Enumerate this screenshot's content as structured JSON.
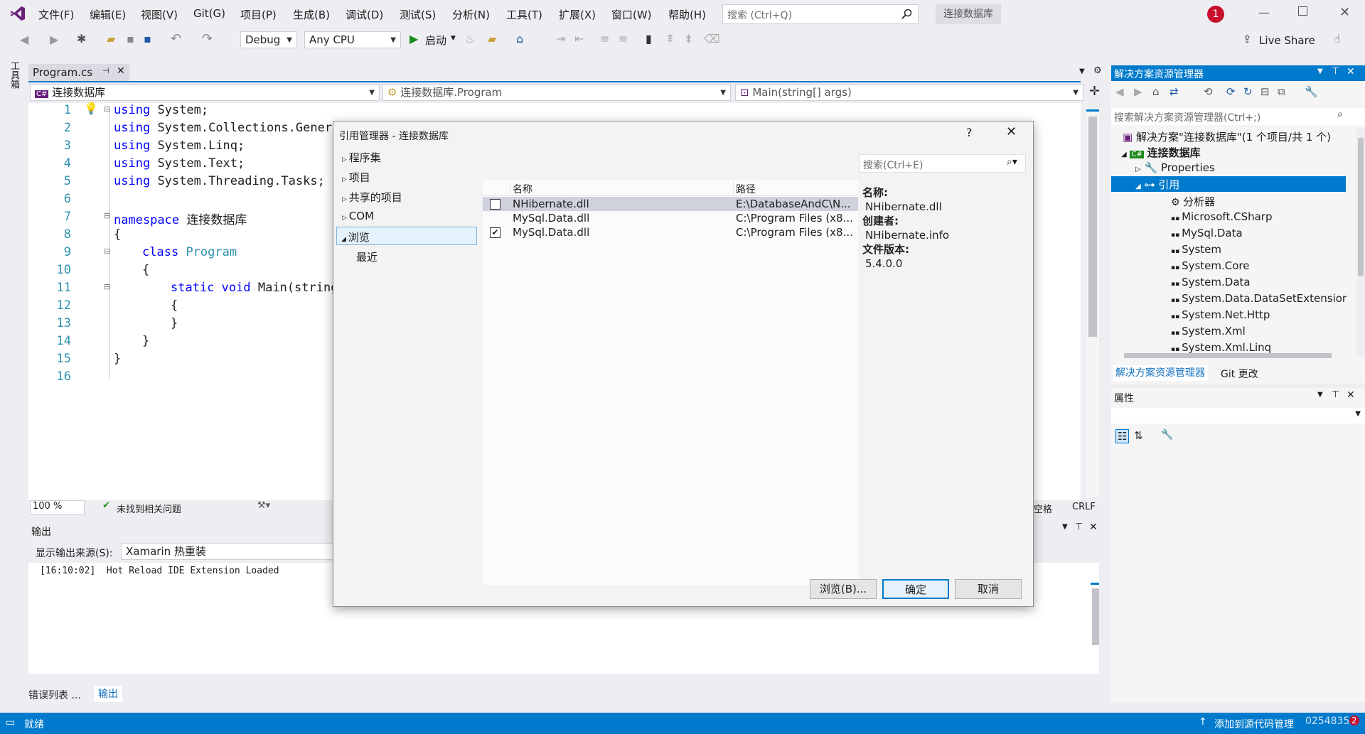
{
  "menu": [
    "文件(F)",
    "编辑(E)",
    "视图(V)",
    "Git(G)",
    "项目(P)",
    "生成(B)",
    "调试(D)",
    "测试(S)",
    "分析(N)",
    "工具(T)",
    "扩展(X)",
    "窗口(W)",
    "帮助(H)"
  ],
  "search": {
    "placeholder": "搜索 (Ctrl+Q)"
  },
  "solution_badge": "连接数据库",
  "notif_count": "1",
  "live_share": "Live Share",
  "toolbar": {
    "config": "Debug",
    "platform": "Any CPU",
    "start": "启动"
  },
  "side_rail": "工具箱",
  "doc_tab": {
    "label": "Program.cs"
  },
  "nav_bar": {
    "project": "连接数据库",
    "class": "连接数据库.Program",
    "member": "Main(string[] args)"
  },
  "code": {
    "line_numbers": [
      "1",
      "2",
      "3",
      "4",
      "5",
      "6",
      "7",
      "8",
      "9",
      "10",
      "11",
      "12",
      "13",
      "14",
      "15",
      "16"
    ],
    "l1": "System;",
    "l2": "System.Collections.Generi",
    "l3": "System.Linq;",
    "l4": "System.Text;",
    "l5": "System.Threading.Tasks;",
    "kw_using": "using",
    "kw_namespace": "namespace",
    "ns_name": "连接数据库",
    "open_brace": "{",
    "close_brace": "}",
    "kw_class": "class",
    "class_name": "Program",
    "kw_static": "static",
    "kw_void": "void",
    "main_sig": "Main(string"
  },
  "editor_status": {
    "zoom": "100 %",
    "issues": "未找到相关问题",
    "spaces": "空格",
    "eol": "CRLF"
  },
  "output": {
    "title": "输出",
    "source_label": "显示输出来源(S):",
    "source_value": "Xamarin 热重装",
    "log": "[16:10:02]  Hot Reload IDE Extension Loaded"
  },
  "bottom_tabs": [
    "错误列表 ...",
    "输出"
  ],
  "dialog": {
    "title": "引用管理器 - 连接数据库",
    "help": "?",
    "nav": [
      "程序集",
      "项目",
      "共享的项目",
      "COM",
      "浏览"
    ],
    "nav_sub": "最近",
    "search_placeholder": "搜索(Ctrl+E)",
    "headers": {
      "name": "名称",
      "path": "路径"
    },
    "rows": [
      {
        "name": "NHibernate.dll",
        "path": "E:\\DatabaseAndC\\N...",
        "checkbox": true,
        "checked": false
      },
      {
        "name": "MySql.Data.dll",
        "path": "C:\\Program Files (x8...",
        "checkbox": false,
        "checked": false
      },
      {
        "name": "MySql.Data.dll",
        "path": "C:\\Program Files (x8...",
        "checkbox": true,
        "checked": true
      }
    ],
    "details": {
      "name_label": "名称:",
      "name_value": "NHibernate.dll",
      "author_label": "创建者:",
      "author_value": "NHibernate.info",
      "version_label": "文件版本:",
      "version_value": "5.4.0.0"
    },
    "buttons": {
      "browse": "浏览(B)...",
      "ok": "确定",
      "cancel": "取消"
    }
  },
  "solution_explorer": {
    "title": "解决方案资源管理器",
    "search_placeholder": "搜索解决方案资源管理器(Ctrl+;)",
    "solution": "解决方案\"连接数据库\"(1 个项目/共 1 个)",
    "project": "连接数据库",
    "properties": "Properties",
    "references": "引用",
    "ref_items": [
      "分析器",
      "Microsoft.CSharp",
      "MySql.Data",
      "System",
      "System.Core",
      "System.Data",
      "System.Data.DataSetExtensior",
      "System.Net.Http",
      "System.Xml",
      "System.Xml.Linq"
    ],
    "tabs": [
      "解决方案资源管理器",
      "Git 更改"
    ]
  },
  "properties_panel": {
    "title": "属性"
  },
  "status_bar": {
    "ready": "就绪",
    "source_control": "添加到源代码管理",
    "watermark": "0254835"
  },
  "colors": {
    "accent": "#007acc",
    "keyword": "#0000ff",
    "type": "#2b91af",
    "selection": "#007acc"
  }
}
